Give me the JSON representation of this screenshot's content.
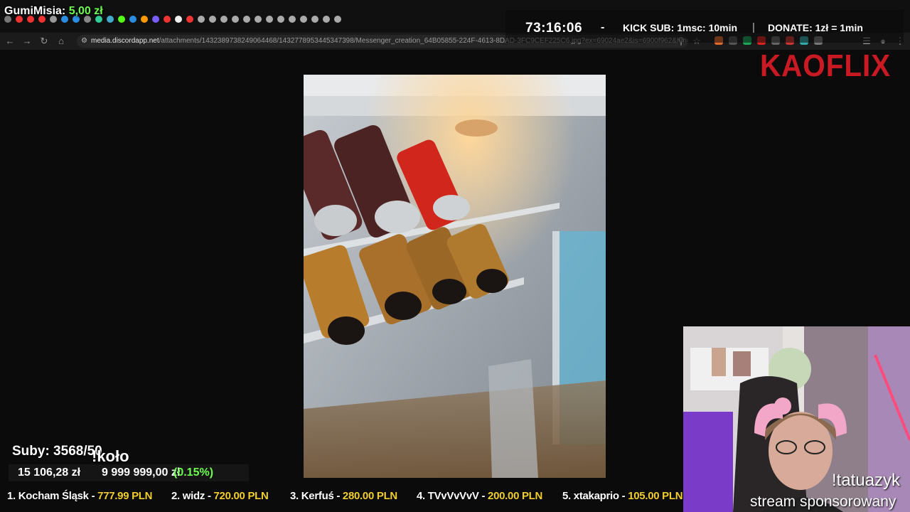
{
  "browser": {
    "url_host": "media.discordapp.net",
    "url_path": "/attachments/1432389738249064468/1432778953445347398/Messenger_creation_64B05855-224F-4613-8DAD-3FC9CEF225C6.jpg?ex=69024ae2&is=6900f962&hm=cb36e3e..."
  },
  "overlay": {
    "donor_name": "GumiMisia:",
    "donor_amount": "5,00 zł",
    "timer": "73:16:06",
    "dash": "-",
    "kick_sub": "KICK SUB: 1msc: 10min",
    "pipe": "|",
    "donate": "DONATE: 1zł = 1min",
    "logo": "KAOFLIX"
  },
  "subs": {
    "label": "Suby: 3568/50",
    "command": "!koło",
    "goal_current": "15 106,28 zł",
    "goal_target": "9 999 999,00 zł",
    "goal_percent": "(0.15%)"
  },
  "webcam": {
    "command": "!tatuazyk",
    "sponsor": "stream sponsorowany"
  },
  "ticker": [
    {
      "rank_name": "1. Kocham Śląsk - ",
      "value": "777.99 PLN"
    },
    {
      "rank_name": "2. widz - ",
      "value": "720.00 PLN"
    },
    {
      "rank_name": "3. Kerfuś - ",
      "value": "280.00 PLN"
    },
    {
      "rank_name": "4. TVvVvVvV - ",
      "value": "200.00 PLN"
    },
    {
      "rank_name": "5. xtakaprio - ",
      "value": "105.00 PLN"
    }
  ],
  "colors": {
    "accent_green": "#6dff4f",
    "ticker_yellow": "#f2cf2a",
    "logo_red": "#c91a24"
  }
}
